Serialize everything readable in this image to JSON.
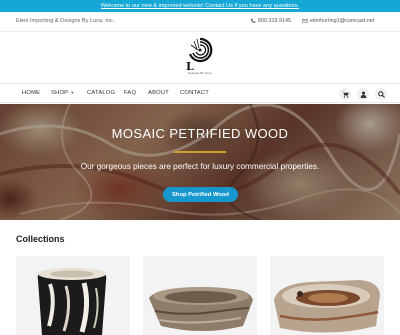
{
  "announcement": {
    "text": "Welcome to our new & improved website! Contact Us if you have any questions."
  },
  "topbar": {
    "company": "Eleni Importing & Designs By Luca, Inc.",
    "phone": "800.319.9145",
    "email": "elenhurting1@comcast.net"
  },
  "logo": {
    "tagline": "Designs By Luca"
  },
  "nav": {
    "items": [
      {
        "label": "HOME"
      },
      {
        "label": "SHOP"
      },
      {
        "label": "CATALOG"
      },
      {
        "label": "FAQ"
      },
      {
        "label": "ABOUT"
      },
      {
        "label": "CONTACT"
      }
    ],
    "icons": [
      "cart-icon",
      "user-icon",
      "search-icon"
    ]
  },
  "hero": {
    "title": "MOSAIC PETRIFIED WOOD",
    "subtitle": "Our gorgeous pieces are perfect for luxury commercial properties.",
    "button_label": "Shop Petrified Wood"
  },
  "collections": {
    "title": "Collections"
  },
  "colors": {
    "accent": "#15a8d6",
    "button": "#1698cf",
    "gold_rule": "#c9a227"
  }
}
